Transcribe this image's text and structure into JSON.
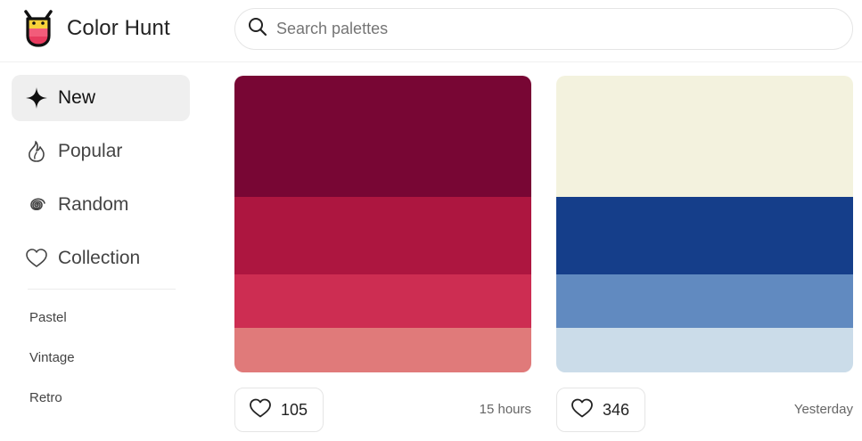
{
  "header": {
    "app_name": "Color Hunt",
    "logo_icon": "color-hunt-logo-icon",
    "search": {
      "placeholder": "Search palettes",
      "value": "",
      "icon": "search-icon"
    }
  },
  "sidebar": {
    "nav": [
      {
        "label": "New",
        "icon": "sparkle-icon",
        "active": true
      },
      {
        "label": "Popular",
        "icon": "flame-icon",
        "active": false
      },
      {
        "label": "Random",
        "icon": "spiral-icon",
        "active": false
      },
      {
        "label": "Collection",
        "icon": "heart-icon",
        "active": false
      }
    ],
    "tags": [
      "Pastel",
      "Vintage",
      "Retro"
    ]
  },
  "palettes": [
    {
      "colors": [
        "#780634",
        "#AD1640",
        "#CD2D52",
        "#E07A7A"
      ],
      "likes": "105",
      "time": "15 hours"
    },
    {
      "colors": [
        "#F3F2DE",
        "#153E8A",
        "#618AC0",
        "#CBDCE9"
      ],
      "likes": "346",
      "time": "Yesterday"
    }
  ]
}
